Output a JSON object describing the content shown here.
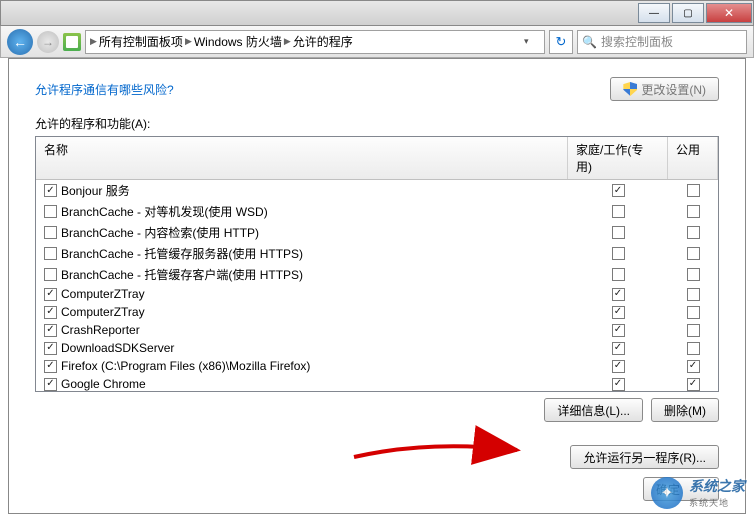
{
  "titlebar": {
    "min": "—",
    "max": "▢",
    "close": "✕"
  },
  "nav": {
    "back": "←",
    "fwd": "→",
    "crumbs": [
      "所有控制面板项",
      "Windows 防火墙",
      "允许的程序"
    ],
    "refresh": "↻",
    "search_placeholder": "搜索控制面板"
  },
  "page": {
    "risk_link": "允许程序通信有哪些风险?",
    "change_settings": "更改设置(N)",
    "list_label": "允许的程序和功能(A):",
    "col_name": "名称",
    "col_home": "家庭/工作(专用)",
    "col_pub": "公用",
    "details": "详细信息(L)...",
    "remove": "删除(M)",
    "allow_another": "允许运行另一程序(R)...",
    "ok": "确定"
  },
  "programs": [
    {
      "name": "Bonjour 服务",
      "name_checked": true,
      "home": true,
      "pub": false
    },
    {
      "name": "BranchCache - 对等机发现(使用 WSD)",
      "name_checked": false,
      "home": false,
      "pub": false
    },
    {
      "name": "BranchCache - 内容检索(使用 HTTP)",
      "name_checked": false,
      "home": false,
      "pub": false
    },
    {
      "name": "BranchCache - 托管缓存服务器(使用 HTTPS)",
      "name_checked": false,
      "home": false,
      "pub": false
    },
    {
      "name": "BranchCache - 托管缓存客户端(使用 HTTPS)",
      "name_checked": false,
      "home": false,
      "pub": false
    },
    {
      "name": "ComputerZTray",
      "name_checked": true,
      "home": true,
      "pub": false
    },
    {
      "name": "ComputerZTray",
      "name_checked": true,
      "home": true,
      "pub": false
    },
    {
      "name": "CrashReporter",
      "name_checked": true,
      "home": true,
      "pub": false
    },
    {
      "name": "DownloadSDKServer",
      "name_checked": true,
      "home": true,
      "pub": false
    },
    {
      "name": "Firefox (C:\\Program Files (x86)\\Mozilla Firefox)",
      "name_checked": true,
      "home": true,
      "pub": true
    },
    {
      "name": "Google Chrome",
      "name_checked": true,
      "home": true,
      "pub": true
    }
  ],
  "watermark": {
    "main": "系统之家",
    "sub": "系统天地"
  }
}
